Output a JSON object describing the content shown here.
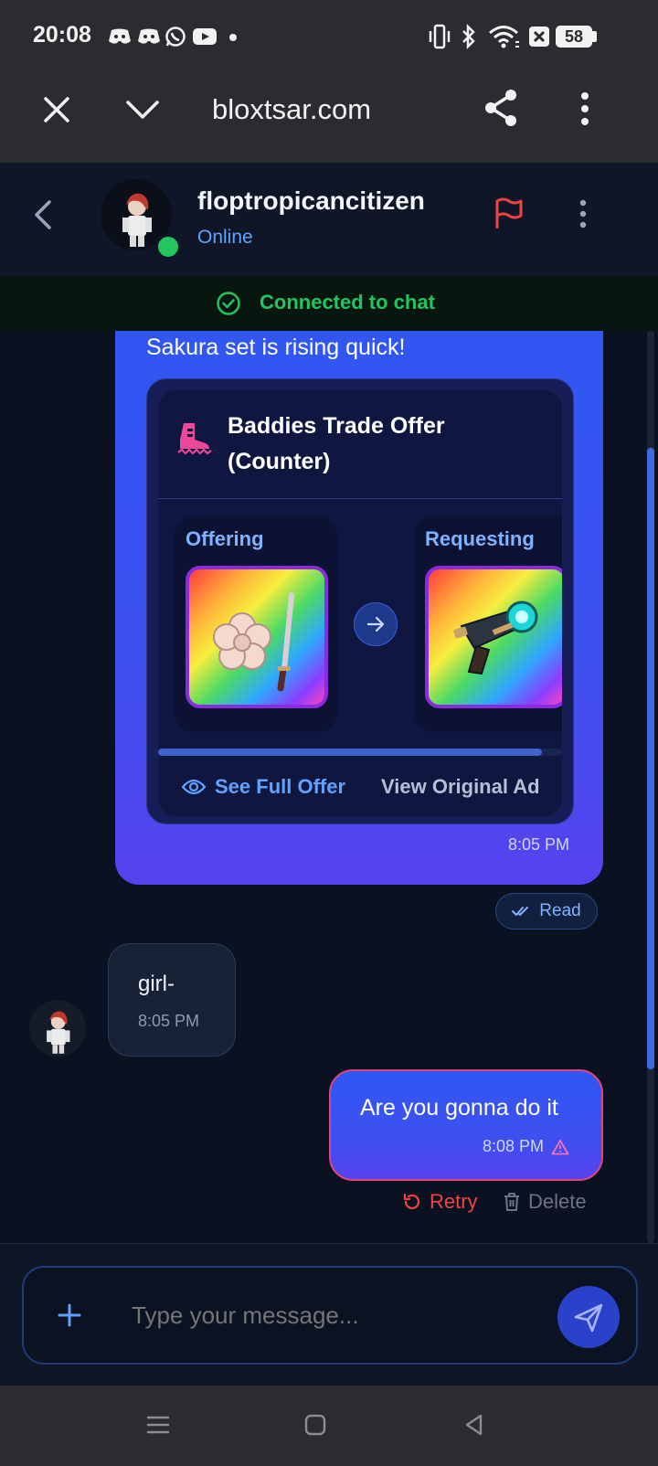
{
  "status_bar": {
    "time": "20:08",
    "battery": "58",
    "left_icons": [
      "discord-icon",
      "discord-icon",
      "whatsapp-icon",
      "youtube-icon",
      "dot-icon"
    ],
    "right_icons": [
      "vibrate-icon",
      "bluetooth-icon",
      "wifi-icon",
      "no-sim-icon",
      "battery-icon"
    ]
  },
  "browser": {
    "url": "bloxtsar.com"
  },
  "chat_header": {
    "username": "floptropicancitizen",
    "status": "Online"
  },
  "banner": {
    "text": "Connected to chat"
  },
  "messages": {
    "first": {
      "text": "Sakura set is rising quick!",
      "time": "8:05 PM",
      "receipt": "Read",
      "trade_card": {
        "title_line1": "Baddies Trade Offer",
        "title_line2": "(Counter)",
        "offering_label": "Offering",
        "requesting_label": "Requesting",
        "see_full_offer": "See Full Offer",
        "view_original_ad": "View Original Ad"
      }
    },
    "incoming": {
      "text": "girl-",
      "time": "8:05 PM"
    },
    "last": {
      "text": "Are you gonna do it",
      "time": "8:08 PM",
      "retry": "Retry",
      "delete": "Delete"
    }
  },
  "composer": {
    "placeholder": "Type your message..."
  },
  "colors": {
    "accent": "#3b5bf2",
    "online": "#22c55e",
    "error": "#ef4444",
    "link": "#5fa3ff"
  }
}
